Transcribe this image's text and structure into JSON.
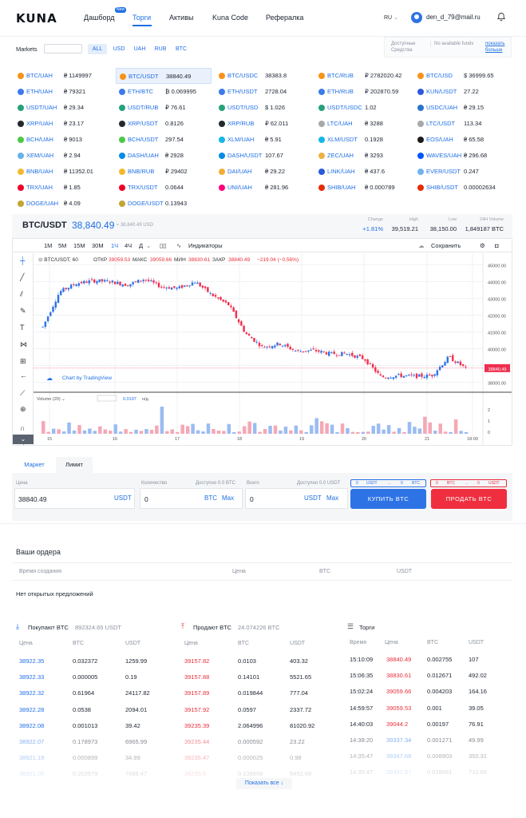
{
  "header": {
    "logo": "KUNA",
    "new_badge": "New",
    "nav": [
      "Дашборд",
      "Торги",
      "Активы",
      "Kuna Code",
      "Рефералка"
    ],
    "lang": "RU",
    "email": "den_d_79@mail.ru"
  },
  "markets": {
    "label": "Markets",
    "tabs": [
      "ALL",
      "USD",
      "UAH",
      "RUB",
      "BTC"
    ],
    "funds_label": "Доступные Средства",
    "funds_value": "No available funds",
    "show_more": "показать больше"
  },
  "pairs": [
    [
      {
        "n": "BTC/UAH",
        "v": "₴ 1149997",
        "c": "#f7931a"
      },
      {
        "n": "BTC/USDT",
        "v": "38840.49",
        "c": "#f7931a",
        "sel": true
      },
      {
        "n": "BTC/USDC",
        "v": "38383.8",
        "c": "#f7931a"
      },
      {
        "n": "BTC/RUB",
        "v": "₽ 2782020.42",
        "c": "#f7931a"
      },
      {
        "n": "BTC/USD",
        "v": "$ 36999.65",
        "c": "#f7931a"
      }
    ],
    [
      {
        "n": "ETH/UAH",
        "v": "₴ 79321",
        "c": "#3c7be8"
      },
      {
        "n": "ETH/BTC",
        "v": "₿ 0.069995",
        "c": "#3c7be8"
      },
      {
        "n": "ETH/USDT",
        "v": "2728.04",
        "c": "#3c7be8"
      },
      {
        "n": "ETH/RUB",
        "v": "₽ 202870.59",
        "c": "#3c7be8"
      },
      {
        "n": "KUN/USDT",
        "v": "27.22",
        "c": "#2f59d6"
      }
    ],
    [
      {
        "n": "USDT/UAH",
        "v": "₴ 29.34",
        "c": "#26a17b"
      },
      {
        "n": "USDT/RUB",
        "v": "₽ 76.61",
        "c": "#26a17b"
      },
      {
        "n": "USDT/USD",
        "v": "$ 1.026",
        "c": "#26a17b"
      },
      {
        "n": "USDT/USDC",
        "v": "1.02",
        "c": "#26a17b"
      },
      {
        "n": "USDC/UAH",
        "v": "₴ 29.15",
        "c": "#2775ca"
      }
    ],
    [
      {
        "n": "XRP/UAH",
        "v": "₴ 23.17",
        "c": "#23292f"
      },
      {
        "n": "XRP/USDT",
        "v": "0.8126",
        "c": "#23292f"
      },
      {
        "n": "XRP/RUB",
        "v": "₽ 62.011",
        "c": "#23292f"
      },
      {
        "n": "LTC/UAH",
        "v": "₴ 3288",
        "c": "#a6a9aa"
      },
      {
        "n": "LTC/USDT",
        "v": "113.34",
        "c": "#a6a9aa"
      }
    ],
    [
      {
        "n": "BCH/UAH",
        "v": "₴ 9013",
        "c": "#4cc947"
      },
      {
        "n": "BCH/USDT",
        "v": "297.54",
        "c": "#4cc947"
      },
      {
        "n": "XLM/UAH",
        "v": "₴ 5.91",
        "c": "#14b6e7"
      },
      {
        "n": "XLM/USDT",
        "v": "0.1928",
        "c": "#14b6e7"
      },
      {
        "n": "EOS/UAH",
        "v": "₴ 65.58",
        "c": "#1b1b1b"
      }
    ],
    [
      {
        "n": "XEM/UAH",
        "v": "₴ 2.94",
        "c": "#67b2e8"
      },
      {
        "n": "DASH/UAH",
        "v": "₴ 2928",
        "c": "#008ce7"
      },
      {
        "n": "DASH/USDT",
        "v": "107.67",
        "c": "#008ce7"
      },
      {
        "n": "ZEC/UAH",
        "v": "₴ 3293",
        "c": "#ecb244"
      },
      {
        "n": "WAVES/UAH",
        "v": "₴ 296.68",
        "c": "#0055ff"
      }
    ],
    [
      {
        "n": "BNB/UAH",
        "v": "₴ 11352.01",
        "c": "#f3ba2f"
      },
      {
        "n": "BNB/RUB",
        "v": "₽ 29402",
        "c": "#f3ba2f"
      },
      {
        "n": "DAI/UAH",
        "v": "₴ 29.22",
        "c": "#f5ac37"
      },
      {
        "n": "LINK/UAH",
        "v": "₴ 437.6",
        "c": "#2a5ada"
      },
      {
        "n": "EVER/USDT",
        "v": "0.247",
        "c": "#6fb3f0"
      }
    ],
    [
      {
        "n": "TRX/UAH",
        "v": "₴ 1.85",
        "c": "#ef0027"
      },
      {
        "n": "TRX/USDT",
        "v": "0.0644",
        "c": "#ef0027"
      },
      {
        "n": "UNI/UAH",
        "v": "₴ 281.96",
        "c": "#ff007a"
      },
      {
        "n": "SHIB/UAH",
        "v": "₴ 0.000789",
        "c": "#e42d04"
      },
      {
        "n": "SHIB/USDT",
        "v": "0.00002634",
        "c": "#e42d04"
      }
    ],
    [
      {
        "n": "DOGE/UAH",
        "v": "₴ 4.09",
        "c": "#c2a633"
      },
      {
        "n": "DOGE/USDT",
        "v": "0.13943",
        "c": "#c2a633"
      }
    ]
  ],
  "ticker": {
    "pair": "BTC/USDT",
    "price": "38,840.49",
    "sub": "≈ 38,840.49 USD",
    "change_label": "Change",
    "change": "+1.81%",
    "high_label": "High",
    "high": "39,519.21",
    "low_label": "Low",
    "low": "38,150.00",
    "vol_label": "24H Volume",
    "vol": "1,849187 BTC"
  },
  "tv": {
    "timeframes": [
      "1М",
      "5М",
      "15М",
      "30М",
      "1Ч",
      "4Ч",
      "Д"
    ],
    "indicators": "Индикаторы",
    "save": "Сохранить",
    "legend_pair": "BTC/USDT, 60",
    "o_l": "ОТКР",
    "o": "39059.53",
    "h_l": "МАКС",
    "h": "39059.66",
    "l_l": "МИН",
    "l": "38830.61",
    "c_l": "ЗАКР",
    "c": "38840.49",
    "chg": "−219.04 (−0.56%)",
    "watermark": "Chart by TradingView",
    "volume_label": "Volume (20)",
    "volume_val": "0.0197",
    "volume_na": "н/д",
    "price_tag": "38840.49",
    "y_ticks": [
      "45000.00",
      "44000.00",
      "43000.00",
      "42000.00",
      "41000.00",
      "40000.00",
      "39000.00",
      "38000.00"
    ],
    "x_ticks": [
      "15",
      "16",
      "17",
      "18",
      "19",
      "20",
      "21",
      "18:00"
    ],
    "vol_ticks": [
      "2",
      "1",
      "0"
    ]
  },
  "chart_data": {
    "type": "candlestick",
    "title": "BTC/USDT, 60",
    "x": [
      "15",
      "16",
      "17",
      "18",
      "19",
      "20",
      "21",
      "18:00"
    ],
    "y": [
      41300,
      43400,
      43900,
      44050,
      44000,
      43800,
      44150,
      43700,
      43600,
      44000,
      43200,
      42600,
      40900,
      40100,
      40300,
      39850,
      39900,
      39700,
      39700,
      39400,
      38300,
      38400,
      38350,
      38400,
      39500,
      38840
    ],
    "ylim": [
      37500,
      45500
    ]
  },
  "form": {
    "tab_market": "Маркет",
    "tab_limit": "Лимит",
    "price_label": "Цена",
    "price": "38840.49",
    "price_unit": "USDT",
    "qty_label": "Количество",
    "qty": "0",
    "qty_unit": "BTC",
    "max": "Max",
    "avail_btc": "Доступно 0.0 BTC",
    "total_label": "Всего",
    "total": "0",
    "total_unit": "USDT",
    "avail_usdt": "Доступно 0.0 USDT",
    "buy_mini": [
      "0",
      "USDT",
      "→",
      "0",
      "BTC"
    ],
    "sell_mini": [
      "0",
      "BTC",
      "→",
      "0",
      "USDT"
    ],
    "buy": "КУПИТЬ BTC",
    "sell": "ПРОДАТЬ BTC"
  },
  "my_orders": {
    "title": "Ваши ордера",
    "cols": [
      "Время создания",
      "Цена",
      "BTC",
      "USDT"
    ],
    "empty": "Нет открытых предложений"
  },
  "buy_book": {
    "title": "Покупают BTC",
    "total": "892324.65 USDT",
    "cols": [
      "Цена",
      "BTC",
      "USDT"
    ],
    "rows": [
      [
        "38922.35",
        "0.032372",
        "1259.99"
      ],
      [
        "38922.33",
        "0.000005",
        "0.19"
      ],
      [
        "38922.32",
        "0.61964",
        "24117.82"
      ],
      [
        "38922.28",
        "0.0538",
        "2094.01"
      ],
      [
        "38922.08",
        "0.001013",
        "39.42"
      ],
      [
        "38922.07",
        "0.178973",
        "6965.99"
      ],
      [
        "38921.19",
        "0.000899",
        "34.99"
      ],
      [
        "38921.05",
        "0.202679",
        "7888.47"
      ]
    ]
  },
  "sell_book": {
    "title": "Продают BTC",
    "total": "24.074226 BTC",
    "cols": [
      "Цена",
      "BTC",
      "USDT"
    ],
    "rows": [
      [
        "39157.82",
        "0.0103",
        "403.32"
      ],
      [
        "39157.88",
        "0.14101",
        "5521.65"
      ],
      [
        "39157.89",
        "0.019844",
        "777.04"
      ],
      [
        "39157.92",
        "0.0597",
        "2337.72"
      ],
      [
        "39235.39",
        "2.064996",
        "81020.92"
      ],
      [
        "39235.44",
        "0.000592",
        "23.22"
      ],
      [
        "39235.47",
        "0.000025",
        "0.98"
      ],
      [
        "39235.5",
        "0.138958",
        "5452.08"
      ]
    ]
  },
  "trades": {
    "title": "Торги",
    "cols": [
      "Время",
      "Цена",
      "BTC",
      "USDT"
    ],
    "rows": [
      [
        "15:10:09",
        "38840.49",
        "0.002755",
        "107",
        "red"
      ],
      [
        "15:06:35",
        "38830.61",
        "0.012671",
        "492.02",
        "red"
      ],
      [
        "15:02:24",
        "39059.66",
        "0.004203",
        "164.16",
        "red"
      ],
      [
        "14:59:57",
        "39059.53",
        "0.001",
        "39.05",
        "red"
      ],
      [
        "14:40:03",
        "39044.2",
        "0.00197",
        "76.91",
        "red"
      ],
      [
        "14:38:20",
        "39337.34",
        "0.001271",
        "49.99",
        "blue"
      ],
      [
        "14:35:47",
        "39347.68",
        "0.008903",
        "350.31",
        "blue"
      ],
      [
        "14:35:47",
        "39347.67",
        "0.018061",
        "710.65",
        "blue"
      ]
    ]
  },
  "show_all": "Показать все ↓"
}
